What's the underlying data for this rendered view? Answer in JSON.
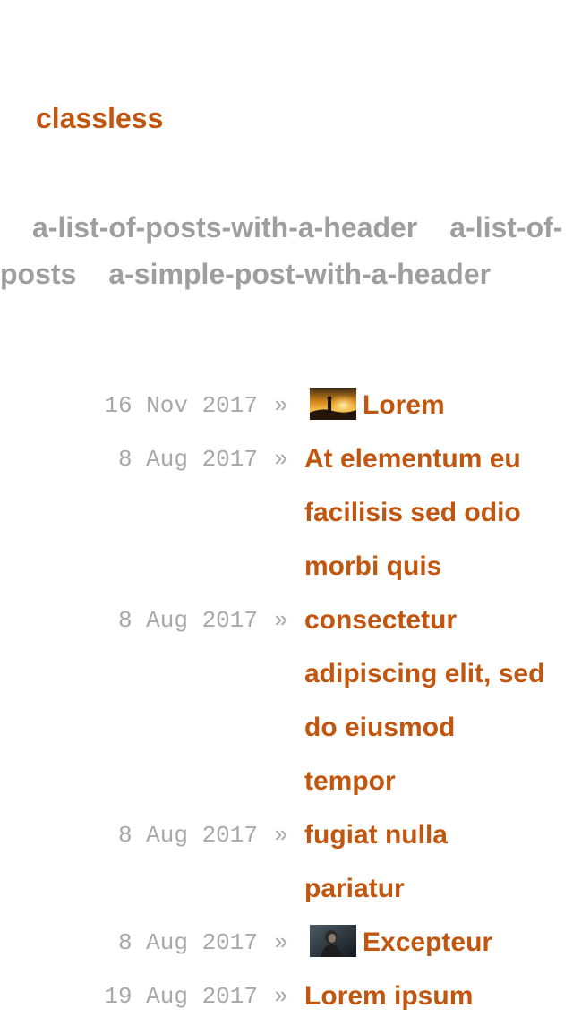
{
  "site": {
    "title": "classless"
  },
  "nav": {
    "items": [
      {
        "label": "a-list-of-posts-with-a-header"
      },
      {
        "label": "a-list-of-posts"
      },
      {
        "label": "a-simple-post-with-a-header"
      }
    ]
  },
  "posts": [
    {
      "date": "16 Nov 2017",
      "sep": "»",
      "title": "Lorem",
      "thumbnail": "sunset-person-thumbnail"
    },
    {
      "date": "8 Aug 2017",
      "sep": "»",
      "title": "At elementum eu facilisis sed odio morbi quis"
    },
    {
      "date": "8 Aug 2017",
      "sep": "»",
      "title": "consectetur adipiscing elit, sed do eiusmod tempor"
    },
    {
      "date": "8 Aug 2017",
      "sep": "»",
      "title": "fugiat nulla pariatur"
    },
    {
      "date": "8 Aug 2017",
      "sep": "»",
      "title": "Excepteur",
      "thumbnail": "dark-portrait-thumbnail"
    },
    {
      "date": "19 Aug 2017",
      "sep": "»",
      "title": "Lorem ipsum"
    }
  ],
  "colors": {
    "accent": "#c0560f",
    "muted": "#9e9e9e",
    "date": "#a8a8a8"
  }
}
